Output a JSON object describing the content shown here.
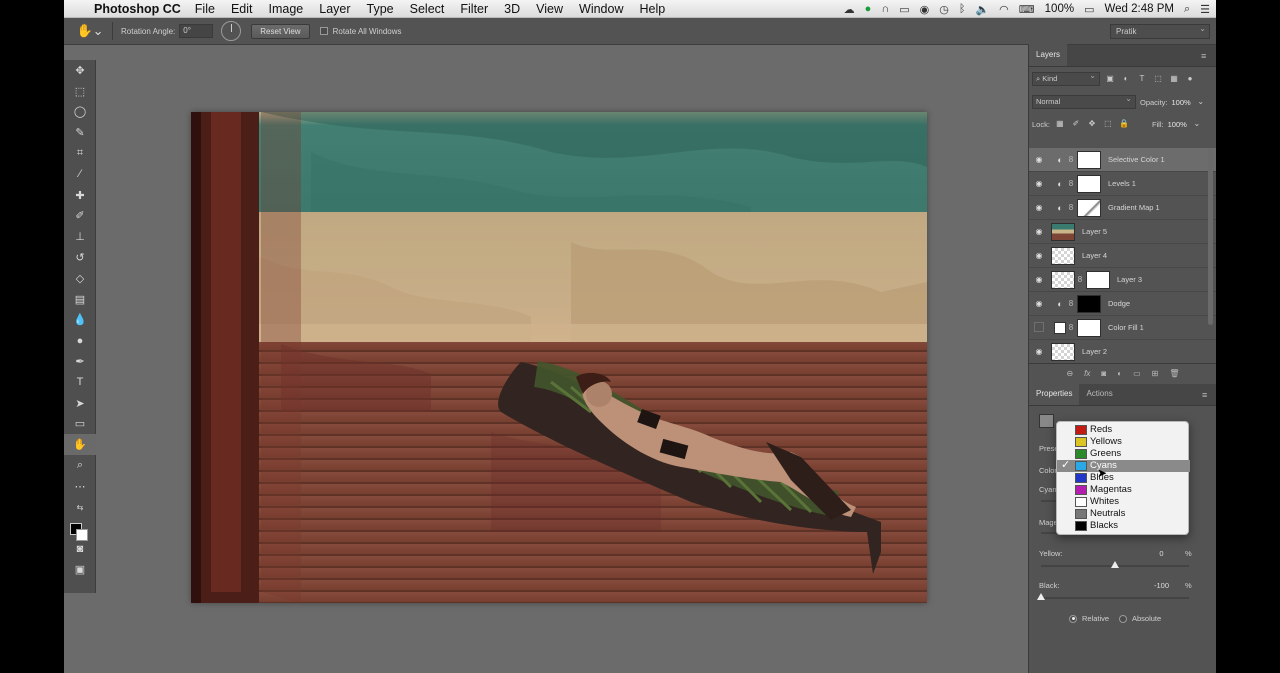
{
  "menubar": {
    "app_name": "Photoshop CC",
    "menus": [
      "File",
      "Edit",
      "Image",
      "Layer",
      "Type",
      "Select",
      "Filter",
      "3D",
      "View",
      "Window",
      "Help"
    ],
    "battery": "100%",
    "clock": "Wed 2:48 PM"
  },
  "options": {
    "rotation_label": "Rotation Angle:",
    "rotation_value": "0°",
    "reset_view": "Reset View",
    "rotate_all": "Rotate All Windows",
    "workspace": "Pratik"
  },
  "layers_panel": {
    "tab": "Layers",
    "kind_filter": "Kind",
    "blend_mode": "Normal",
    "opacity_label": "Opacity:",
    "opacity_value": "100%",
    "lock_label": "Lock:",
    "fill_label": "Fill:",
    "fill_value": "100%",
    "layers": [
      {
        "name": "Selective Color 1",
        "visible": true,
        "selected": true,
        "kind": "adjustment"
      },
      {
        "name": "Levels 1",
        "visible": true,
        "selected": false,
        "kind": "adjustment"
      },
      {
        "name": "Gradient Map 1",
        "visible": true,
        "selected": false,
        "kind": "adjustment"
      },
      {
        "name": "Layer 5",
        "visible": true,
        "selected": false,
        "kind": "photo"
      },
      {
        "name": "Layer 4",
        "visible": true,
        "selected": false,
        "kind": "empty"
      },
      {
        "name": "Layer 3",
        "visible": true,
        "selected": false,
        "kind": "masked"
      },
      {
        "name": "Dodge",
        "visible": true,
        "selected": false,
        "kind": "adjustment-dark"
      },
      {
        "name": "Color Fill 1",
        "visible": false,
        "selected": false,
        "kind": "fill"
      },
      {
        "name": "Layer 2",
        "visible": true,
        "selected": false,
        "kind": "empty"
      }
    ]
  },
  "properties_panel": {
    "tabs": [
      "Properties",
      "Actions"
    ],
    "preset_label": "Prese",
    "colors_label": "Color",
    "cyan_label": "Cyan",
    "magenta_label": "Mage",
    "yellow_label": "Yellow:",
    "yellow_value": "0",
    "black_label": "Black:",
    "black_value": "-100",
    "percent": "%",
    "relative_label": "Relative",
    "absolute_label": "Absolute",
    "relative_selected": true
  },
  "colors_dropdown": {
    "selected": "Cyans",
    "options": [
      {
        "label": "Reds",
        "color": "#c41a14"
      },
      {
        "label": "Yellows",
        "color": "#dcc522"
      },
      {
        "label": "Greens",
        "color": "#2c8a2a"
      },
      {
        "label": "Cyans",
        "color": "#29a9e6"
      },
      {
        "label": "Blues",
        "color": "#2137c9"
      },
      {
        "label": "Magentas",
        "color": "#b51db0"
      },
      {
        "label": "Whites",
        "color": "#ffffff"
      },
      {
        "label": "Neutrals",
        "color": "#777777"
      },
      {
        "label": "Blacks",
        "color": "#000000"
      }
    ]
  },
  "colors": {
    "ui_dark": "#535353",
    "canvas_bg": "#6b6b6b",
    "selection": "#6c6c6c"
  }
}
